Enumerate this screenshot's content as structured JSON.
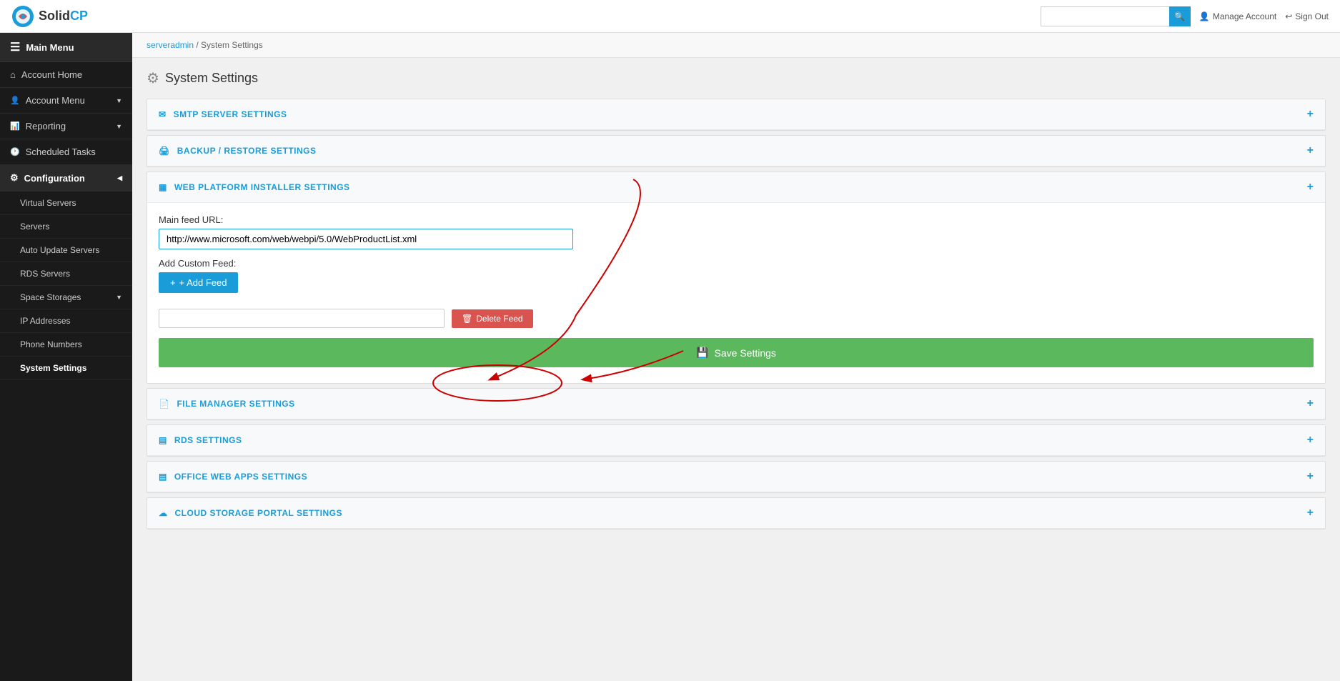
{
  "app": {
    "logo_text_solid": "Solid",
    "logo_text_cp": "CP",
    "search_placeholder": ""
  },
  "top_nav": {
    "manage_account": "Manage Account",
    "sign_out": "Sign Out"
  },
  "sidebar": {
    "main_menu_label": "Main Menu",
    "items": [
      {
        "id": "account-home",
        "label": "Account Home",
        "icon": "home",
        "active": false,
        "sub": []
      },
      {
        "id": "account-menu",
        "label": "Account Menu",
        "icon": "user",
        "active": false,
        "has_arrow": true,
        "sub": []
      },
      {
        "id": "reporting",
        "label": "Reporting",
        "icon": "chart",
        "active": false,
        "has_arrow": true,
        "sub": []
      },
      {
        "id": "scheduled-tasks",
        "label": "Scheduled Tasks",
        "icon": "clock",
        "active": false,
        "sub": []
      },
      {
        "id": "configuration",
        "label": "Configuration",
        "icon": "gear",
        "active": true,
        "has_arrow": true,
        "sub": [
          {
            "id": "virtual-servers",
            "label": "Virtual Servers"
          },
          {
            "id": "servers",
            "label": "Servers"
          },
          {
            "id": "auto-update-servers",
            "label": "Auto Update Servers"
          },
          {
            "id": "rds-servers",
            "label": "RDS Servers"
          },
          {
            "id": "space-storages",
            "label": "Space Storages",
            "has_arrow": true
          },
          {
            "id": "ip-addresses",
            "label": "IP Addresses"
          },
          {
            "id": "phone-numbers",
            "label": "Phone Numbers"
          },
          {
            "id": "system-settings",
            "label": "System Settings",
            "active": true
          }
        ]
      }
    ]
  },
  "breadcrumb": {
    "parent": "serveradmin",
    "separator": "/",
    "current": "System Settings"
  },
  "page": {
    "title": "System Settings"
  },
  "sections": [
    {
      "id": "smtp",
      "icon": "email",
      "label": "SMTP SERVER SETTINGS",
      "expanded": false
    },
    {
      "id": "backup",
      "icon": "backup",
      "label": "BACKUP / RESTORE SETTINGS",
      "expanded": false
    },
    {
      "id": "wpi",
      "icon": "web",
      "label": "WEB PLATFORM INSTALLER SETTINGS",
      "expanded": true,
      "fields": {
        "main_feed_label": "Main feed URL:",
        "main_feed_value": "http://www.microsoft.com/web/webpi/5.0/WebProductList.xml",
        "add_custom_feed_label": "Add Custom Feed:",
        "add_feed_btn": "+ Add Feed",
        "delete_feed_btn": "Delete Feed",
        "save_settings_btn": "Save Settings"
      }
    },
    {
      "id": "file-manager",
      "icon": "file",
      "label": "FILE MANAGER SETTINGS",
      "expanded": false
    },
    {
      "id": "rds",
      "icon": "rds",
      "label": "RDS SETTINGS",
      "expanded": false
    },
    {
      "id": "office-web-apps",
      "icon": "office",
      "label": "OFFICE WEB APPS SETTINGS",
      "expanded": false
    },
    {
      "id": "cloud-storage",
      "icon": "cloud",
      "label": "CLOUD STORAGE PORTAL SETTINGS",
      "expanded": false
    }
  ]
}
